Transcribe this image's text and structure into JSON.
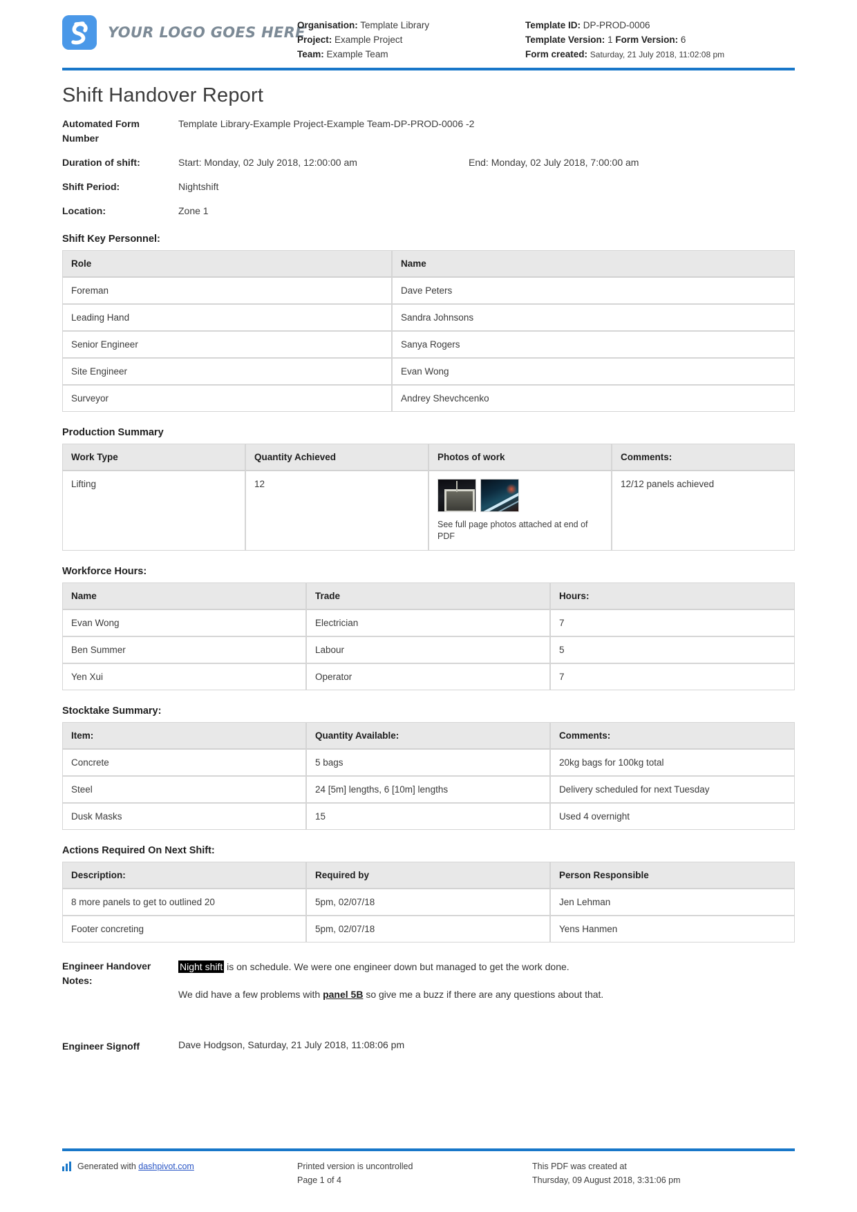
{
  "header": {
    "logo_text": "YOUR LOGO GOES HERE",
    "logo_icon": "dashpivot-logo-icon",
    "organisation_label": "Organisation:",
    "organisation_value": "Template Library",
    "project_label": "Project:",
    "project_value": "Example Project",
    "team_label": "Team:",
    "team_value": "Example Team",
    "template_id_label": "Template ID:",
    "template_id_value": "DP-PROD-0006",
    "template_version_label": "Template Version:",
    "template_version_value": "1",
    "form_version_label": "Form Version:",
    "form_version_value": "6",
    "form_created_label": "Form created:",
    "form_created_value": "Saturday, 21 July 2018, 11:02:08 pm",
    "accent_color": "#1877c9"
  },
  "document": {
    "title": "Shift Handover Report",
    "automated_form_number_label": "Automated Form Number",
    "automated_form_number_value": "Template Library-Example Project-Example Team-DP-PROD-0006   -2",
    "duration_label": "Duration of shift:",
    "duration_start": "Start: Monday, 02 July 2018, 12:00:00 am",
    "duration_end": "End: Monday, 02 July 2018, 7:00:00 am",
    "shift_period_label": "Shift Period:",
    "shift_period_value": "Nightshift",
    "location_label": "Location:",
    "location_value": "Zone 1"
  },
  "personnel": {
    "section_title": "Shift Key Personnel:",
    "columns": [
      "Role",
      "Name"
    ],
    "rows": [
      [
        "Foreman",
        "Dave Peters"
      ],
      [
        "Leading Hand",
        "Sandra Johnsons"
      ],
      [
        "Senior Engineer",
        "Sanya Rogers"
      ],
      [
        "Site Engineer",
        "Evan Wong"
      ],
      [
        "Surveyor",
        "Andrey Shevchcenko"
      ]
    ]
  },
  "production": {
    "section_title": "Production Summary",
    "columns": [
      "Work Type",
      "Quantity Achieved",
      "Photos of work",
      "Comments:"
    ],
    "work_type": "Lifting",
    "quantity_achieved": "12",
    "photo_note": "See full page photos attached at end of PDF",
    "comments": "12/12 panels achieved"
  },
  "workforce": {
    "section_title": "Workforce Hours:",
    "columns": [
      "Name",
      "Trade",
      "Hours:"
    ],
    "rows": [
      [
        "Evan Wong",
        "Electrician",
        "7"
      ],
      [
        "Ben Summer",
        "Labour",
        "5"
      ],
      [
        "Yen Xui",
        "Operator",
        "7"
      ]
    ]
  },
  "stocktake": {
    "section_title": "Stocktake Summary:",
    "columns": [
      "Item:",
      "Quantity Available:",
      "Comments:"
    ],
    "rows": [
      [
        "Concrete",
        "5 bags",
        "20kg bags for 100kg total"
      ],
      [
        "Steel",
        "24 [5m] lengths, 6 [10m] lengths",
        "Delivery scheduled for next Tuesday"
      ],
      [
        "Dusk Masks",
        "15",
        "Used 4 overnight"
      ]
    ]
  },
  "actions": {
    "section_title": "Actions Required On Next Shift:",
    "columns": [
      "Description:",
      "Required by",
      "Person Responsible"
    ],
    "rows": [
      [
        "8 more panels to get to outlined 20",
        "5pm, 02/07/18",
        "Jen Lehman"
      ],
      [
        "Footer concreting",
        "5pm, 02/07/18",
        "Yens Hanmen"
      ]
    ]
  },
  "notes": {
    "label": "Engineer Handover Notes:",
    "para1_highlight": "Night shift",
    "para1_rest": " is on schedule. We were one engineer down but managed to get the work done.",
    "para2_pre": "We did have a few problems with ",
    "para2_emph": "panel 5B",
    "para2_post": " so give me a buzz if there are any questions about that."
  },
  "signoff": {
    "label": "Engineer Signoff",
    "value": "Dave Hodgson, Saturday, 21 July 2018, 11:08:06 pm"
  },
  "footer": {
    "generated_prefix": "Generated with ",
    "generated_link": "dashpivot.com",
    "printed_notice": "Printed version is uncontrolled",
    "page_number": "Page 1 of 4",
    "created_label": "This PDF was created at",
    "created_value": "Thursday, 09 August 2018, 3:31:06 pm",
    "bars_icon": "bar-chart-icon"
  }
}
